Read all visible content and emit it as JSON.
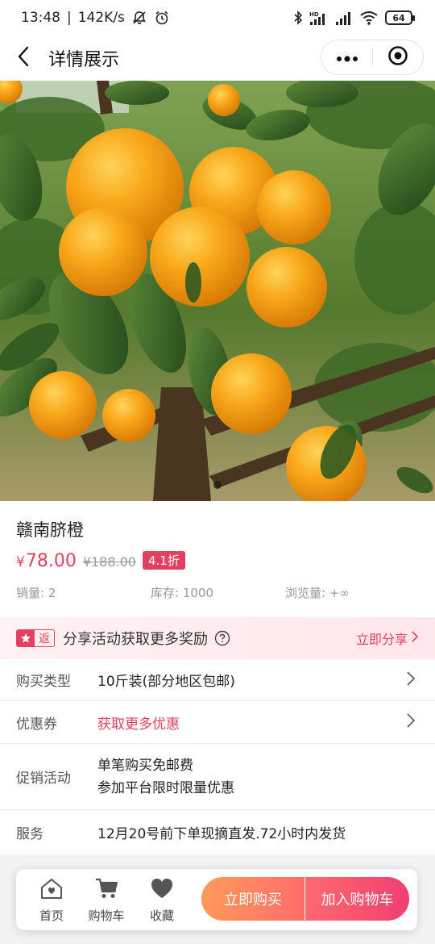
{
  "status_bar": {
    "time": "13:48",
    "network_speed": "142K/s",
    "battery": "64",
    "icons": [
      "mute-icon",
      "alarm-icon",
      "bluetooth-icon",
      "hd-signal-icon",
      "signal-icon",
      "wifi-icon",
      "battery-icon"
    ]
  },
  "nav": {
    "title": "详情展示",
    "back_icon": "chevron-left-icon",
    "more_icon": "more-dots-icon",
    "close_icon": "target-close-icon"
  },
  "product": {
    "name": "赣南脐橙",
    "currency": "¥",
    "price": "78.00",
    "original_price": "¥188.00",
    "discount": "4.1折",
    "sales": "销量: 2",
    "stock": "库存: 1000",
    "views": "浏览量: +∞",
    "image_carousel_dots": 1
  },
  "share": {
    "tag": "返",
    "text": "分享活动获取更多奖励",
    "action": "立即分享"
  },
  "details": [
    {
      "label": "购买类型",
      "value": "10斤装(部分地区包邮)",
      "has_arrow": true
    },
    {
      "label": "优惠券",
      "value": "获取更多优惠",
      "has_arrow": true
    },
    {
      "label": "促销活动",
      "values": [
        "单笔购买免邮费",
        "参加平台限时限量优惠"
      ],
      "has_arrow": false
    },
    {
      "label": "服务",
      "value": "12月20号前下单现摘直发.72小时内发货",
      "has_arrow": false
    }
  ],
  "bottom_bar": {
    "tabs": [
      {
        "label": "首页",
        "icon": "home-icon"
      },
      {
        "label": "购物车",
        "icon": "cart-icon"
      },
      {
        "label": "收藏",
        "icon": "heart-icon"
      }
    ],
    "buy_now": "立即购买",
    "add_to_cart": "加入购物车"
  },
  "colors": {
    "accent": "#e2405e",
    "buy_gradient": [
      "#ff9a5a",
      "#ff6d6a"
    ],
    "cart_gradient": [
      "#ff6a6f",
      "#f03f72"
    ]
  }
}
